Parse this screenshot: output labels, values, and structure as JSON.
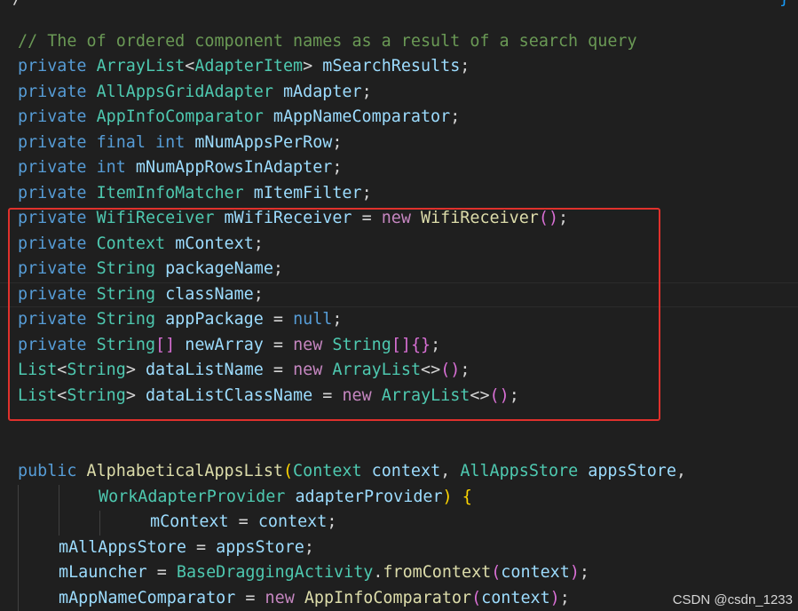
{
  "editor": {
    "comment": "// The of ordered component names as a result of a search query",
    "lines": {
      "l1": {
        "kw": "private",
        "type": "ArrayList",
        "generic_open": "<",
        "generic_type": "AdapterItem",
        "generic_close": ">",
        "name": "mSearchResults",
        "end": ";"
      },
      "l2": {
        "kw": "private",
        "type": "AllAppsGridAdapter",
        "name": "mAdapter",
        "end": ";"
      },
      "l3": {
        "kw": "private",
        "type": "AppInfoComparator",
        "name": "mAppNameComparator",
        "end": ";"
      },
      "l4": {
        "kw": "private",
        "kw2": "final",
        "type": "int",
        "name": "mNumAppsPerRow",
        "end": ";"
      },
      "l5": {
        "kw": "private",
        "type": "int",
        "name": "mNumAppRowsInAdapter",
        "end": ";"
      },
      "l6": {
        "kw": "private",
        "type": "ItemInfoMatcher",
        "name": "mItemFilter",
        "end": ";"
      },
      "l7": {
        "kw": "private",
        "type": "WifiReceiver",
        "name": "mWifiReceiver",
        "eq": "=",
        "new": "new",
        "ctor": "WifiReceiver",
        "args": "()",
        "end": ";"
      },
      "l8": {
        "kw": "private",
        "type": "Context",
        "name": "mContext",
        "end": ";"
      },
      "l9": {
        "kw": "private",
        "type": "String",
        "name": "packageName",
        "end": ";"
      },
      "l10": {
        "kw": "private",
        "type": "String",
        "name": "className",
        "end": ";"
      },
      "l11": {
        "kw": "private",
        "type": "String",
        "name": "appPackage",
        "eq": "=",
        "val": "null",
        "end": ";"
      },
      "l12": {
        "kw": "private",
        "type": "String",
        "arr": "[]",
        "name": "newArray",
        "eq": "=",
        "new": "new",
        "ctor": "String",
        "arr2": "[]",
        "init": "{}",
        "end": ";"
      },
      "l13": {
        "type": "List",
        "generic_open": "<",
        "generic_type": "String",
        "generic_close": ">",
        "name": "dataListName",
        "eq": "=",
        "new": "new",
        "ctor": "ArrayList",
        "diamond": "<>",
        "args": "()",
        "end": ";"
      },
      "l14": {
        "type": "List",
        "generic_open": "<",
        "generic_type": "String",
        "generic_close": ">",
        "name": "dataListClassName",
        "eq": "=",
        "new": "new",
        "ctor": "ArrayList",
        "diamond": "<>",
        "args": "()",
        "end": ";"
      },
      "l15": {
        "kw": "public",
        "fn": "AlphabeticalAppsList",
        "paren": "(",
        "t1": "Context",
        "p1": "context",
        "comma": ",",
        "t2": "AllAppsStore",
        "p2": "appsStore",
        "comma2": ","
      },
      "l16": {
        "t3": "WorkAdapterProvider",
        "p3": "adapterProvider",
        "close": ")",
        "brace": "{"
      },
      "l17": {
        "name": "mContext",
        "eq": "=",
        "val": "context",
        "end": ";"
      },
      "l18": {
        "name": "mAllAppsStore",
        "eq": "=",
        "val": "appsStore",
        "end": ";"
      },
      "l19": {
        "name": "mLauncher",
        "eq": "=",
        "cls": "BaseDraggingActivity",
        "dot": ".",
        "fn": "fromContext",
        "open": "(",
        "arg": "context",
        "close": ")",
        "end": ";"
      },
      "l20": {
        "name": "mAppNameComparator",
        "eq": "=",
        "new": "new",
        "ctor": "AppInfoComparator",
        "open": "(",
        "arg": "context",
        "close": ")",
        "end": ";"
      }
    }
  },
  "watermark": "CSDN @csdn_1233",
  "colors": {
    "background": "#1f1f1f",
    "keyword": "#569cd6",
    "type": "#4ec9b0",
    "variable": "#9cdcfe",
    "function": "#dcdcaa",
    "comment": "#6a9955",
    "highlight_border": "#e0312c"
  }
}
